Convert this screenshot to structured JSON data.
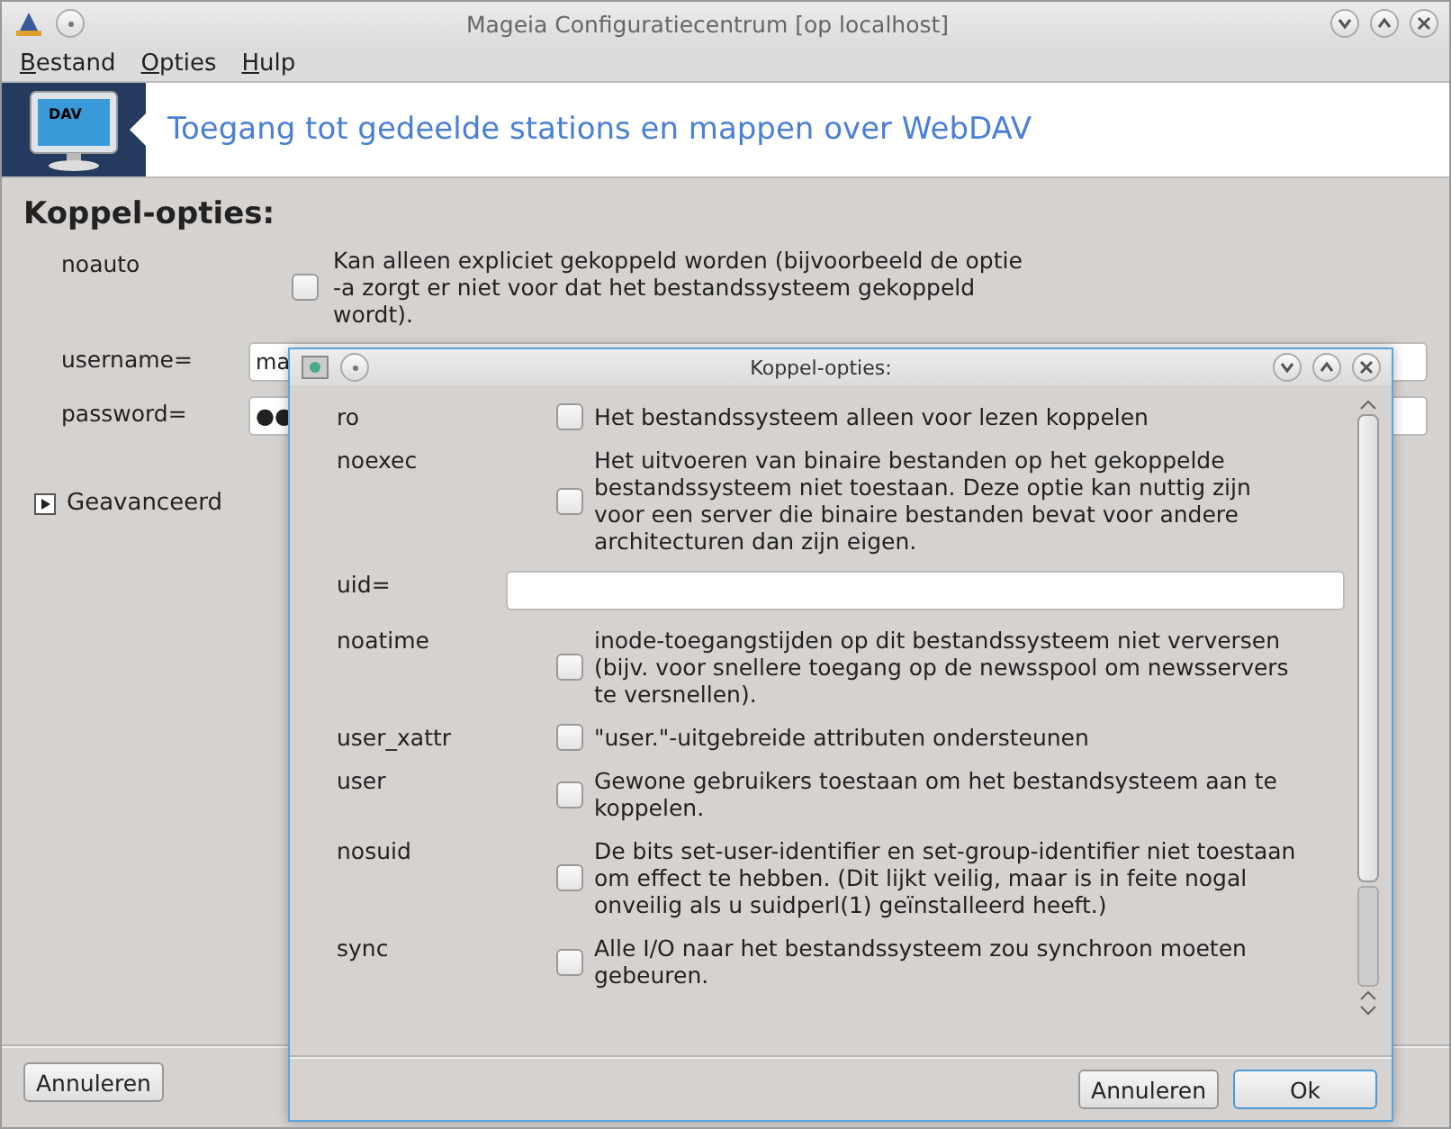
{
  "window": {
    "title": "Mageia Configuratiecentrum  [op localhost]"
  },
  "menu": [
    {
      "label": "Bestand"
    },
    {
      "label": "Opties"
    },
    {
      "label": "Hulp"
    }
  ],
  "banner": {
    "icon_text": "DAV",
    "title": "Toegang tot gedeelde stations en mappen over WebDAV"
  },
  "main": {
    "heading": "Koppel-opties:",
    "options": [
      {
        "kind": "checkbox",
        "label": "noauto",
        "description": "Kan alleen expliciet gekoppeld worden (bijvoorbeeld de optie -a zorgt er niet voor dat het bestandssysteem gekoppeld wordt).",
        "checked": false
      },
      {
        "kind": "field",
        "label": "username=",
        "value": "ma"
      },
      {
        "kind": "field",
        "label": "password=",
        "value": "●●"
      }
    ],
    "expander": {
      "label": "Geavanceerd",
      "expanded": false
    },
    "buttons": [
      "Annuleren"
    ]
  },
  "dialog": {
    "title": "Koppel-opties:",
    "options": [
      {
        "kind": "checkbox",
        "label": "ro",
        "description": "Het bestandssysteem alleen voor lezen koppelen",
        "checked": false
      },
      {
        "kind": "checkbox",
        "label": "noexec",
        "description": "Het uitvoeren van binaire bestanden op het gekoppelde bestandssysteem niet toestaan. Deze optie kan nuttig zijn voor een server die binaire bestanden bevat voor andere architecturen dan zijn eigen.",
        "checked": false
      },
      {
        "kind": "field",
        "label": "uid="
      },
      {
        "kind": "checkbox",
        "label": "noatime",
        "description": "inode-toegangstijden op dit bestandssysteem niet verversen (bijv. voor snellere toegang op de newsspool om newsservers te versnellen).",
        "checked": false
      },
      {
        "kind": "checkbox",
        "label": "user_xattr",
        "description": "\"user.\"-uitgebreide attributen ondersteunen",
        "checked": false
      },
      {
        "kind": "checkbox",
        "label": "user",
        "description": "Gewone gebruikers toestaan om het bestandsysteem aan te koppelen.",
        "checked": false
      },
      {
        "kind": "checkbox",
        "label": "nosuid",
        "description": "De bits set-user-identifier en set-group-identifier niet toestaan om effect te hebben. (Dit lijkt veilig, maar is in feite nogal onveilig als u suidperl(1) geïnstalleerd heeft.)",
        "checked": false
      },
      {
        "kind": "checkbox",
        "label": "sync",
        "description": "Alle I/O naar het bestandssysteem zou synchroon moeten gebeuren.",
        "checked": false
      }
    ],
    "buttons": [
      {
        "label": "Annuleren",
        "default": false
      },
      {
        "label": "Ok",
        "default": true
      }
    ]
  }
}
